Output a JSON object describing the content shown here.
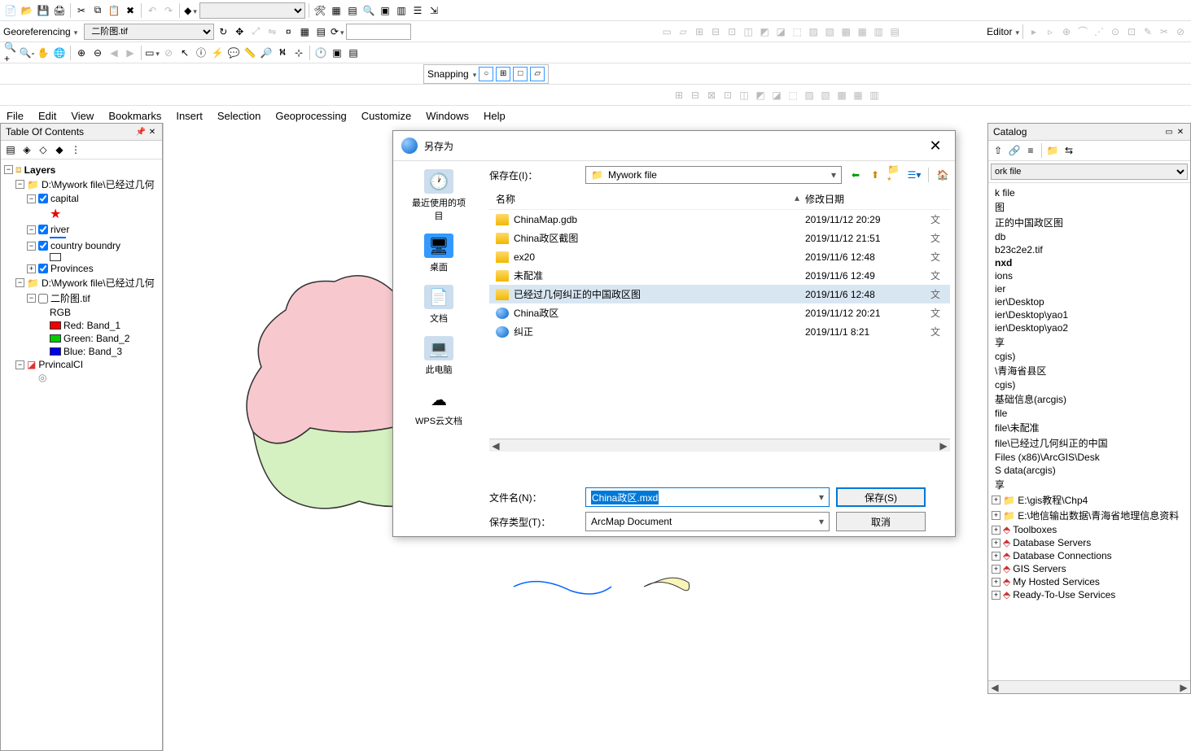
{
  "toolbars": {
    "georeferencing_label": "Georeferencing",
    "georef_layer": "二阶图.tif",
    "snapping_label": "Snapping",
    "editor_label": "Editor"
  },
  "menu": [
    "File",
    "Edit",
    "View",
    "Bookmarks",
    "Insert",
    "Selection",
    "Geoprocessing",
    "Customize",
    "Windows",
    "Help"
  ],
  "toc": {
    "title": "Table Of Contents",
    "layers_label": "Layers",
    "group1_path": "D:\\Mywork file\\已经过几何",
    "capital": "capital",
    "river": "river",
    "country_boundary": "country boundry",
    "provinces": "Provinces",
    "group2_path": "D:\\Mywork file\\已经过几何",
    "raster_name": "二阶图.tif",
    "rgb_label": "RGB",
    "band1": "Red:    Band_1",
    "band2": "Green: Band_2",
    "band3": "Blue:   Band_3",
    "prvincal": "PrvincalCI"
  },
  "catalog": {
    "title": "Catalog",
    "location": "ork file",
    "items": [
      "k file",
      "图",
      "正的中国政区图",
      "db",
      "b23c2e2.tif",
      "nxd",
      "ions",
      "ier",
      "ier\\Desktop",
      "ier\\Desktop\\yao1",
      "ier\\Desktop\\yao2",
      "享",
      "cgis)",
      "\\青海省县区",
      "cgis)",
      "基础信息(arcgis)",
      "file",
      "file\\未配准",
      "file\\已经过几何纠正的中国",
      "Files (x86)\\ArcGIS\\Desk",
      "S data(arcgis)",
      "享"
    ],
    "folders": [
      "E:\\gis教程\\Chp4",
      "E:\\地信输出数据\\青海省地理信息资料"
    ],
    "services": [
      "Toolboxes",
      "Database Servers",
      "Database Connections",
      "GIS Servers",
      "My Hosted Services",
      "Ready-To-Use Services"
    ]
  },
  "dialog": {
    "title": "另存为",
    "save_in_label": "保存在(I)：",
    "save_in_value": "Mywork file",
    "header_name": "名称",
    "header_date": "修改日期",
    "files": [
      {
        "name": "ChinaMap.gdb",
        "date": "2019/11/12 20:29",
        "type": "folder"
      },
      {
        "name": "China政区截图",
        "date": "2019/11/12 21:51",
        "type": "folder"
      },
      {
        "name": "ex20",
        "date": "2019/11/6 12:48",
        "type": "folder"
      },
      {
        "name": "未配准",
        "date": "2019/11/6 12:49",
        "type": "folder"
      },
      {
        "name": "已经过几何纠正的中国政区图",
        "date": "2019/11/6 12:48",
        "type": "folder",
        "selected": true
      },
      {
        "name": "China政区",
        "date": "2019/11/12 20:21",
        "type": "mxd"
      },
      {
        "name": "纠正",
        "date": "2019/11/1 8:21",
        "type": "mxd"
      }
    ],
    "places": [
      {
        "label": "最近使用的项目"
      },
      {
        "label": "桌面"
      },
      {
        "label": "文档"
      },
      {
        "label": "此电脑"
      },
      {
        "label": "WPS云文档"
      }
    ],
    "filename_label": "文件名(N)：",
    "filename_value": "China政区.mxd",
    "filetype_label": "保存类型(T)：",
    "filetype_value": "ArcMap Document",
    "save_btn": "保存(S)",
    "cancel_btn": "取消"
  }
}
